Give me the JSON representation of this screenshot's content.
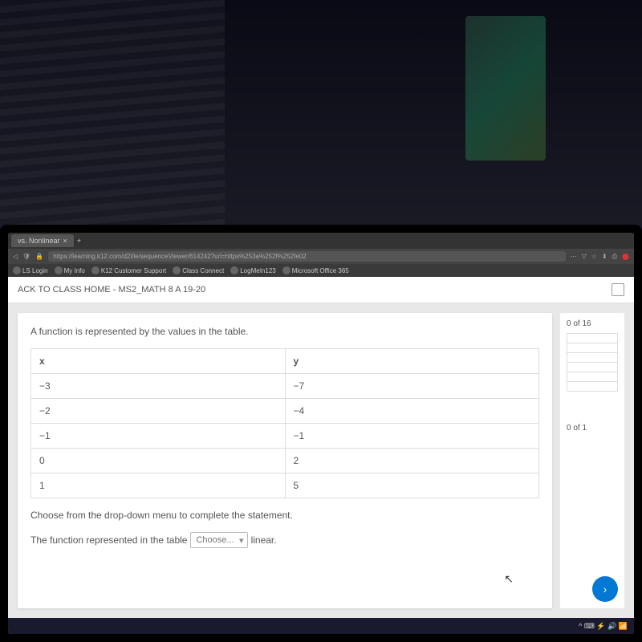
{
  "browser": {
    "tab_title": "vs. Nonlinear",
    "url": "https://learning.k12.com/d2l/le/sequenceViewer/614242?url=https%253a%252f%252fe02",
    "bookmarks": [
      "LS Login",
      "My Info",
      "K12 Customer Support",
      "Class Connect",
      "LogMeIn123",
      "Microsoft Office 365"
    ]
  },
  "header": {
    "breadcrumb": "ACK TO CLASS HOME - MS2_MATH 8 A 19-20"
  },
  "question": {
    "prompt": "A function is represented by the values in the table.",
    "table": {
      "headers": [
        "x",
        "y"
      ],
      "rows": [
        {
          "x": "−3",
          "y": "−7"
        },
        {
          "x": "−2",
          "y": "−4"
        },
        {
          "x": "−1",
          "y": "−1"
        },
        {
          "x": "0",
          "y": "2"
        },
        {
          "x": "1",
          "y": "5"
        }
      ]
    },
    "instruction": "Choose from the drop-down menu to complete the statement.",
    "statement_before": "The function represented in the table",
    "dropdown_value": "Choose...",
    "statement_after": "linear."
  },
  "sidebar": {
    "progress_top": "0 of 16",
    "progress_bottom": "0 of 1"
  },
  "taskbar": {
    "tray": "^ ⌨ ⚡ 🔊 📶 "
  }
}
